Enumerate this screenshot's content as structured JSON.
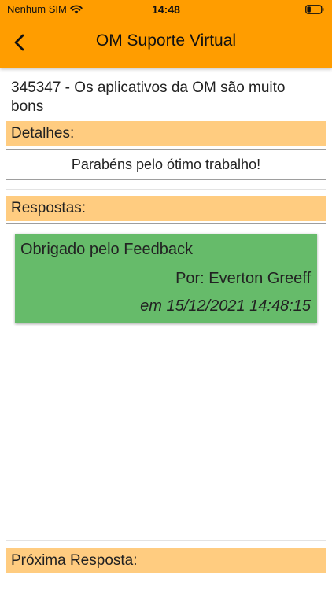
{
  "status_bar": {
    "carrier": "Nenhum SIM",
    "time": "14:48",
    "wifi_icon": "wifi-icon",
    "battery_icon": "battery-icon"
  },
  "nav": {
    "title": "OM Suporte Virtual",
    "back_icon": "chevron-left-icon",
    "bar_color": "#ff9d00"
  },
  "ticket": {
    "title": "345347 - Os aplicativos da OM são muito bons"
  },
  "details": {
    "header": "Detalhes:",
    "text": "Parabéns pelo ótimo trabalho!",
    "header_color": "#ffcc80"
  },
  "responses": {
    "header": "Respostas:",
    "items": [
      {
        "message": "Obrigado pelo Feedback",
        "author": "Por: Everton Greeff",
        "date": "em 15/12/2021 14:48:15",
        "color": "#66bb6a"
      }
    ]
  },
  "next_response": {
    "header": "Próxima Resposta:"
  }
}
